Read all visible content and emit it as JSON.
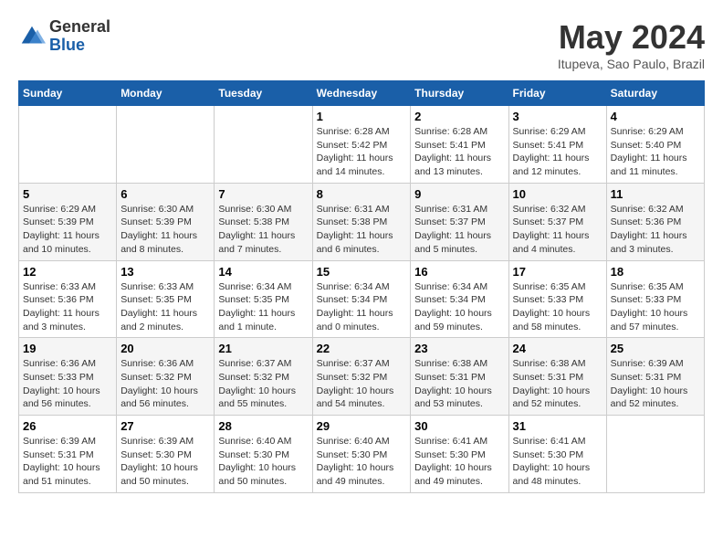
{
  "logo": {
    "general": "General",
    "blue": "Blue"
  },
  "title": "May 2024",
  "location": "Itupeva, Sao Paulo, Brazil",
  "days_of_week": [
    "Sunday",
    "Monday",
    "Tuesday",
    "Wednesday",
    "Thursday",
    "Friday",
    "Saturday"
  ],
  "weeks": [
    {
      "days": [
        {
          "number": "",
          "info": ""
        },
        {
          "number": "",
          "info": ""
        },
        {
          "number": "",
          "info": ""
        },
        {
          "number": "1",
          "info": "Sunrise: 6:28 AM\nSunset: 5:42 PM\nDaylight: 11 hours and 14 minutes."
        },
        {
          "number": "2",
          "info": "Sunrise: 6:28 AM\nSunset: 5:41 PM\nDaylight: 11 hours and 13 minutes."
        },
        {
          "number": "3",
          "info": "Sunrise: 6:29 AM\nSunset: 5:41 PM\nDaylight: 11 hours and 12 minutes."
        },
        {
          "number": "4",
          "info": "Sunrise: 6:29 AM\nSunset: 5:40 PM\nDaylight: 11 hours and 11 minutes."
        }
      ]
    },
    {
      "days": [
        {
          "number": "5",
          "info": "Sunrise: 6:29 AM\nSunset: 5:39 PM\nDaylight: 11 hours and 10 minutes."
        },
        {
          "number": "6",
          "info": "Sunrise: 6:30 AM\nSunset: 5:39 PM\nDaylight: 11 hours and 8 minutes."
        },
        {
          "number": "7",
          "info": "Sunrise: 6:30 AM\nSunset: 5:38 PM\nDaylight: 11 hours and 7 minutes."
        },
        {
          "number": "8",
          "info": "Sunrise: 6:31 AM\nSunset: 5:38 PM\nDaylight: 11 hours and 6 minutes."
        },
        {
          "number": "9",
          "info": "Sunrise: 6:31 AM\nSunset: 5:37 PM\nDaylight: 11 hours and 5 minutes."
        },
        {
          "number": "10",
          "info": "Sunrise: 6:32 AM\nSunset: 5:37 PM\nDaylight: 11 hours and 4 minutes."
        },
        {
          "number": "11",
          "info": "Sunrise: 6:32 AM\nSunset: 5:36 PM\nDaylight: 11 hours and 3 minutes."
        }
      ]
    },
    {
      "days": [
        {
          "number": "12",
          "info": "Sunrise: 6:33 AM\nSunset: 5:36 PM\nDaylight: 11 hours and 3 minutes."
        },
        {
          "number": "13",
          "info": "Sunrise: 6:33 AM\nSunset: 5:35 PM\nDaylight: 11 hours and 2 minutes."
        },
        {
          "number": "14",
          "info": "Sunrise: 6:34 AM\nSunset: 5:35 PM\nDaylight: 11 hours and 1 minute."
        },
        {
          "number": "15",
          "info": "Sunrise: 6:34 AM\nSunset: 5:34 PM\nDaylight: 11 hours and 0 minutes."
        },
        {
          "number": "16",
          "info": "Sunrise: 6:34 AM\nSunset: 5:34 PM\nDaylight: 10 hours and 59 minutes."
        },
        {
          "number": "17",
          "info": "Sunrise: 6:35 AM\nSunset: 5:33 PM\nDaylight: 10 hours and 58 minutes."
        },
        {
          "number": "18",
          "info": "Sunrise: 6:35 AM\nSunset: 5:33 PM\nDaylight: 10 hours and 57 minutes."
        }
      ]
    },
    {
      "days": [
        {
          "number": "19",
          "info": "Sunrise: 6:36 AM\nSunset: 5:33 PM\nDaylight: 10 hours and 56 minutes."
        },
        {
          "number": "20",
          "info": "Sunrise: 6:36 AM\nSunset: 5:32 PM\nDaylight: 10 hours and 56 minutes."
        },
        {
          "number": "21",
          "info": "Sunrise: 6:37 AM\nSunset: 5:32 PM\nDaylight: 10 hours and 55 minutes."
        },
        {
          "number": "22",
          "info": "Sunrise: 6:37 AM\nSunset: 5:32 PM\nDaylight: 10 hours and 54 minutes."
        },
        {
          "number": "23",
          "info": "Sunrise: 6:38 AM\nSunset: 5:31 PM\nDaylight: 10 hours and 53 minutes."
        },
        {
          "number": "24",
          "info": "Sunrise: 6:38 AM\nSunset: 5:31 PM\nDaylight: 10 hours and 52 minutes."
        },
        {
          "number": "25",
          "info": "Sunrise: 6:39 AM\nSunset: 5:31 PM\nDaylight: 10 hours and 52 minutes."
        }
      ]
    },
    {
      "days": [
        {
          "number": "26",
          "info": "Sunrise: 6:39 AM\nSunset: 5:31 PM\nDaylight: 10 hours and 51 minutes."
        },
        {
          "number": "27",
          "info": "Sunrise: 6:39 AM\nSunset: 5:30 PM\nDaylight: 10 hours and 50 minutes."
        },
        {
          "number": "28",
          "info": "Sunrise: 6:40 AM\nSunset: 5:30 PM\nDaylight: 10 hours and 50 minutes."
        },
        {
          "number": "29",
          "info": "Sunrise: 6:40 AM\nSunset: 5:30 PM\nDaylight: 10 hours and 49 minutes."
        },
        {
          "number": "30",
          "info": "Sunrise: 6:41 AM\nSunset: 5:30 PM\nDaylight: 10 hours and 49 minutes."
        },
        {
          "number": "31",
          "info": "Sunrise: 6:41 AM\nSunset: 5:30 PM\nDaylight: 10 hours and 48 minutes."
        },
        {
          "number": "",
          "info": ""
        }
      ]
    }
  ]
}
